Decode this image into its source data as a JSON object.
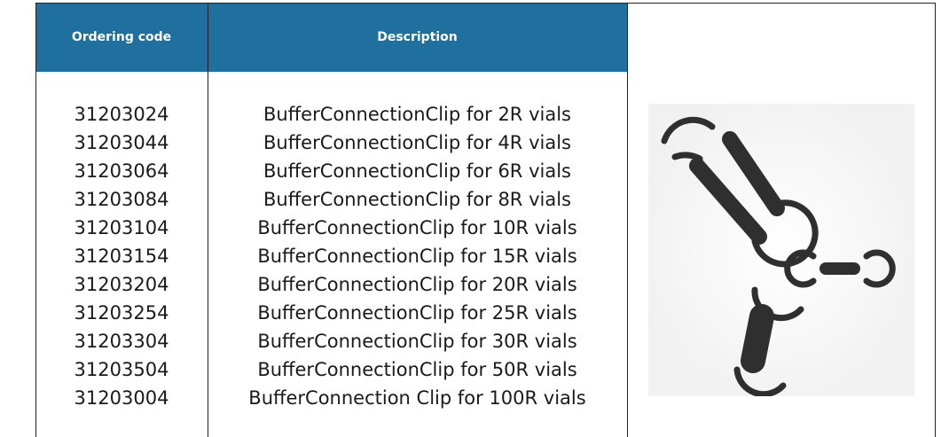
{
  "table": {
    "headers": {
      "code": "Ordering code",
      "description": "Description"
    },
    "rows": [
      {
        "code": "31203024",
        "description": "BufferConnectionClip for 2R vials"
      },
      {
        "code": "31203044",
        "description": "BufferConnectionClip for 4R vials"
      },
      {
        "code": "31203064",
        "description": "BufferConnectionClip for 6R vials"
      },
      {
        "code": "31203084",
        "description": "BufferConnectionClip for 8R vials"
      },
      {
        "code": "31203104",
        "description": "BufferConnectionClip for 10R vials"
      },
      {
        "code": "31203154",
        "description": "BufferConnectionClip for 15R vials"
      },
      {
        "code": "31203204",
        "description": "BufferConnectionClip for 20R vials"
      },
      {
        "code": "31203254",
        "description": "BufferConnectionClip for 25R vials"
      },
      {
        "code": "31203304",
        "description": "BufferConnectionClip for 30R vials"
      },
      {
        "code": "31203504",
        "description": "BufferConnectionClip for 50R vials"
      },
      {
        "code": "31203004",
        "description": "BufferConnection Clip for 100R vials"
      }
    ]
  },
  "colors": {
    "header_background": "#1f6f9f",
    "header_text": "#ffffff",
    "clip_color": "#2f2f2f"
  },
  "image": {
    "icon": "buffer-connection-clips-photo"
  }
}
